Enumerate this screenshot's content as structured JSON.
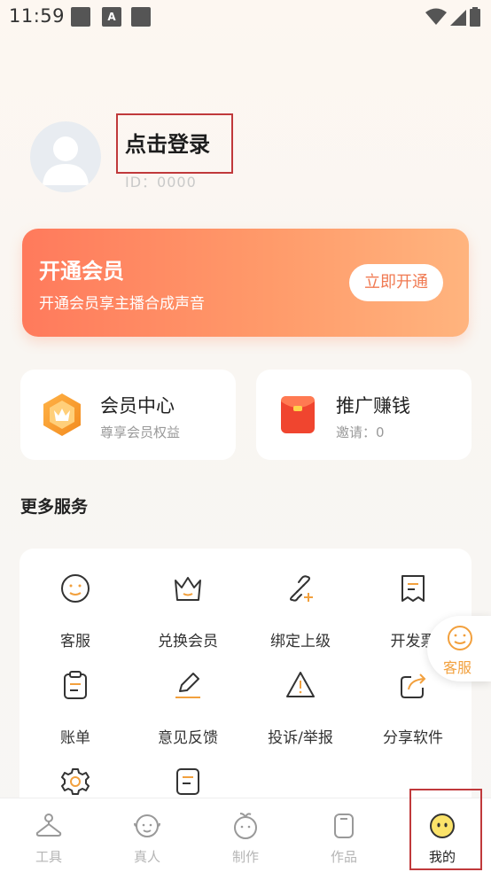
{
  "status_bar": {
    "time": "11:59",
    "a_badge": "A"
  },
  "profile": {
    "login_label": "点击登录",
    "user_id": "ID：0000"
  },
  "vip_banner": {
    "title": "开通会员",
    "subtitle": "开通会员享主播合成声音",
    "button_label": "立即开通"
  },
  "cards": [
    {
      "title": "会员中心",
      "subtitle": "尊享会员权益",
      "icon": "crown-badge-icon"
    },
    {
      "title": "推广赚钱",
      "subtitle": "邀请：0",
      "icon": "red-envelope-icon"
    }
  ],
  "more_services": {
    "title": "更多服务",
    "items": [
      {
        "label": "客服",
        "icon": "smiley-face-icon"
      },
      {
        "label": "兑换会员",
        "icon": "crown-icon"
      },
      {
        "label": "绑定上级",
        "icon": "link-add-icon"
      },
      {
        "label": "开发票",
        "icon": "invoice-icon"
      },
      {
        "label": "账单",
        "icon": "clipboard-icon"
      },
      {
        "label": "意见反馈",
        "icon": "pencil-icon"
      },
      {
        "label": "投诉/举报",
        "icon": "warning-icon"
      },
      {
        "label": "分享软件",
        "icon": "share-icon"
      },
      {
        "label": "",
        "icon": "gear-icon"
      },
      {
        "label": "",
        "icon": "document-icon"
      }
    ]
  },
  "float_service": {
    "label": "客服"
  },
  "tabbar": {
    "tabs": [
      {
        "label": "工具",
        "icon": "hanger-icon"
      },
      {
        "label": "真人",
        "icon": "person-face-icon"
      },
      {
        "label": "制作",
        "icon": "sprout-face-icon"
      },
      {
        "label": "作品",
        "icon": "phone-frame-icon"
      },
      {
        "label": "我的",
        "icon": "emoji-face-icon",
        "active": true
      }
    ]
  },
  "colors": {
    "accent": "#f2a03d",
    "banner_start": "#ff7a5c",
    "banner_end": "#ffb47e",
    "highlight_red": "#c0393b"
  }
}
